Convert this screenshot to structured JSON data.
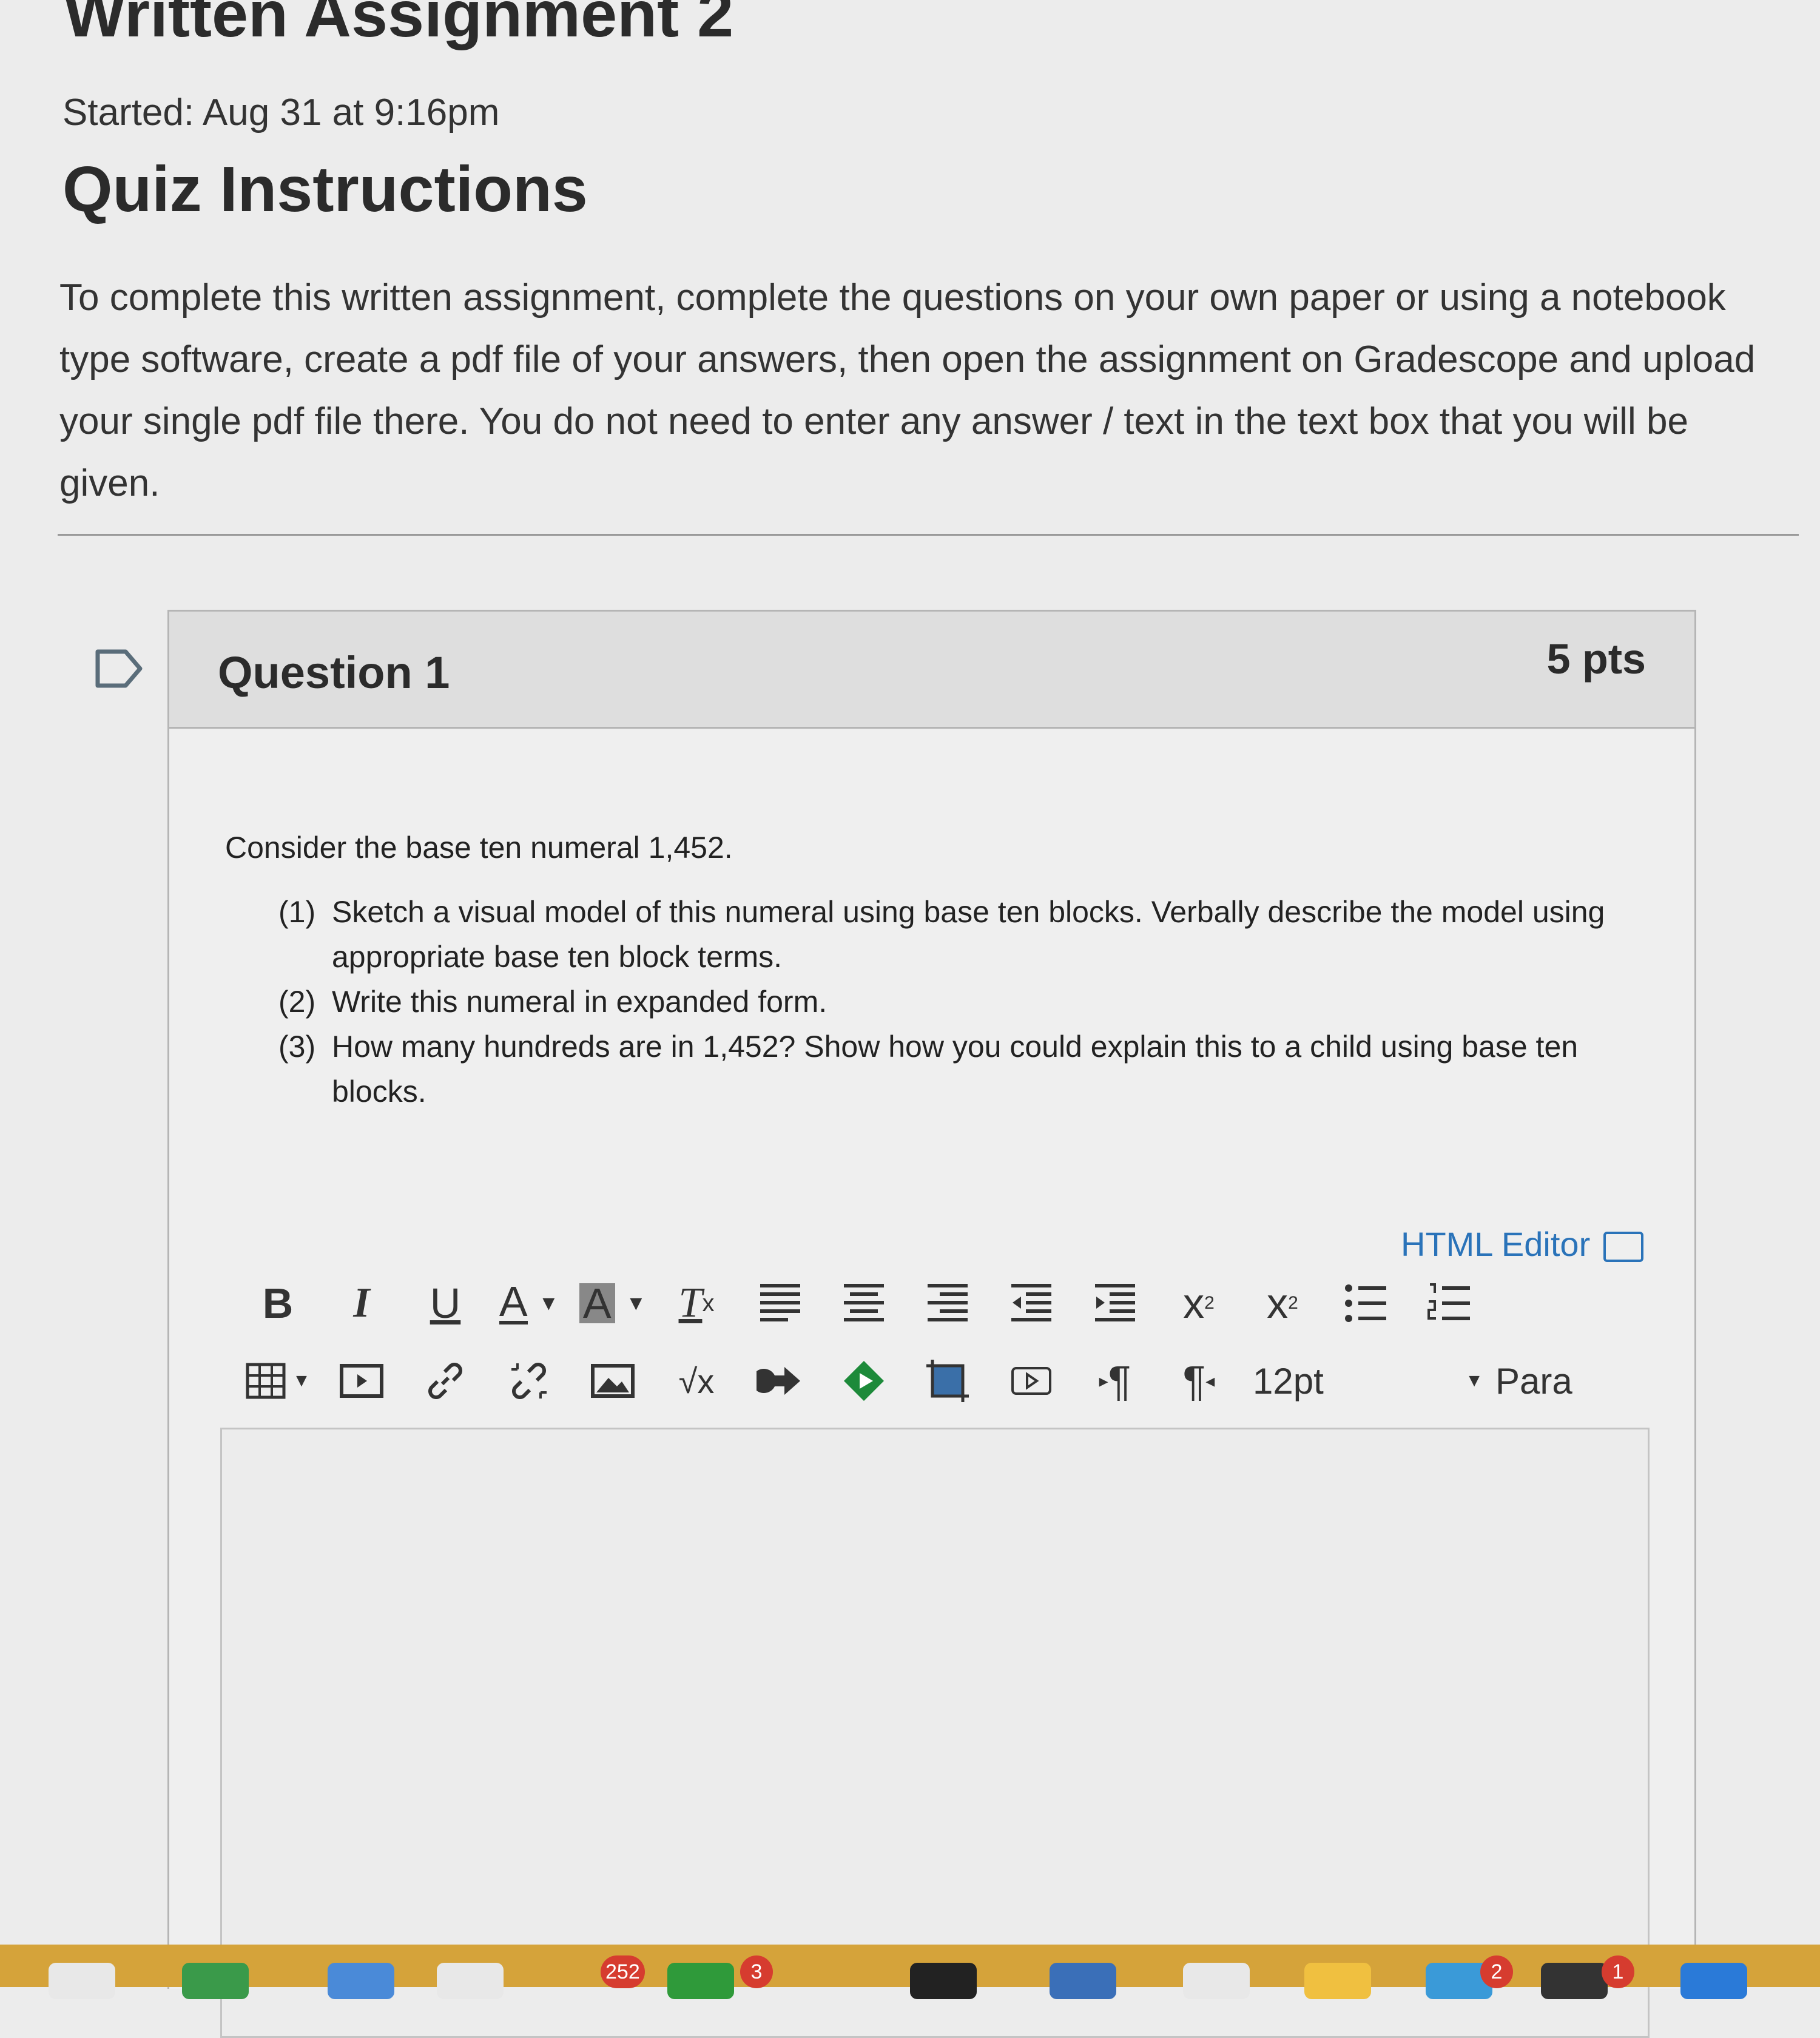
{
  "page": {
    "title": "Written Assignment 2",
    "started": "Started: Aug 31 at 9:16pm"
  },
  "instructions": {
    "heading": "Quiz Instructions",
    "text": "To complete this written assignment, complete the questions on your own paper or using a notebook type software, create a pdf file of your answers, then open the assignment on Gradescope and upload your single pdf file there.  You do not need to enter any answer / text in the text box that you will be given."
  },
  "question": {
    "title": "Question 1",
    "points": "5 pts",
    "intro": "Consider the base ten numeral 1,452.",
    "items": [
      {
        "num": "(1)",
        "text": "Sketch a visual model of this numeral using base ten blocks.  Verbally describe the model using appropriate base ten block terms."
      },
      {
        "num": "(2)",
        "text": "Write this numeral in expanded form."
      },
      {
        "num": "(3)",
        "text": "How many hundreds are in 1,452?  Show how you could explain this to a child using base ten blocks."
      }
    ]
  },
  "editor": {
    "html_editor_label": "HTML Editor",
    "font_size": "12pt",
    "paragraph_label": "Para",
    "toolbar_row1": [
      "bold-icon",
      "italic-icon",
      "underline-icon",
      "font-color-icon",
      "background-color-icon",
      "clear-formatting-icon",
      "align-left-icon",
      "align-center-icon",
      "align-right-icon",
      "outdent-icon",
      "indent-icon",
      "superscript-icon",
      "subscript-icon",
      "bullet-list-icon",
      "numbered-list-icon"
    ],
    "toolbar_row2": [
      "table-icon",
      "media-icon",
      "link-icon",
      "unlink-icon",
      "image-icon",
      "equation-icon",
      "embed-icon",
      "apps-icon",
      "crop-image-icon",
      "record-media-icon",
      "ltr-icon",
      "rtl-icon"
    ]
  },
  "dock": {
    "badges": [
      "252",
      "3",
      "2",
      "1"
    ]
  }
}
